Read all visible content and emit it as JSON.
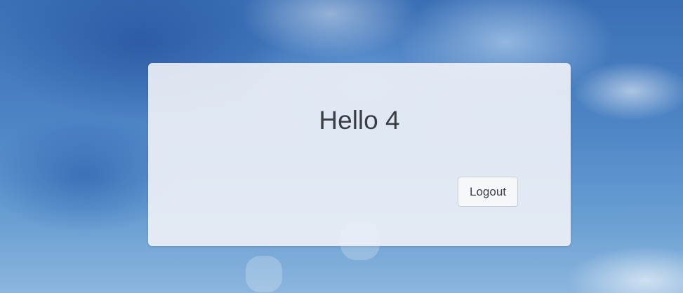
{
  "card": {
    "greeting": "Hello 4",
    "logout_label": "Logout"
  },
  "colors": {
    "card_background": "#f0f2f7",
    "text": "#3b3f45",
    "sky": "#4f86c6"
  }
}
